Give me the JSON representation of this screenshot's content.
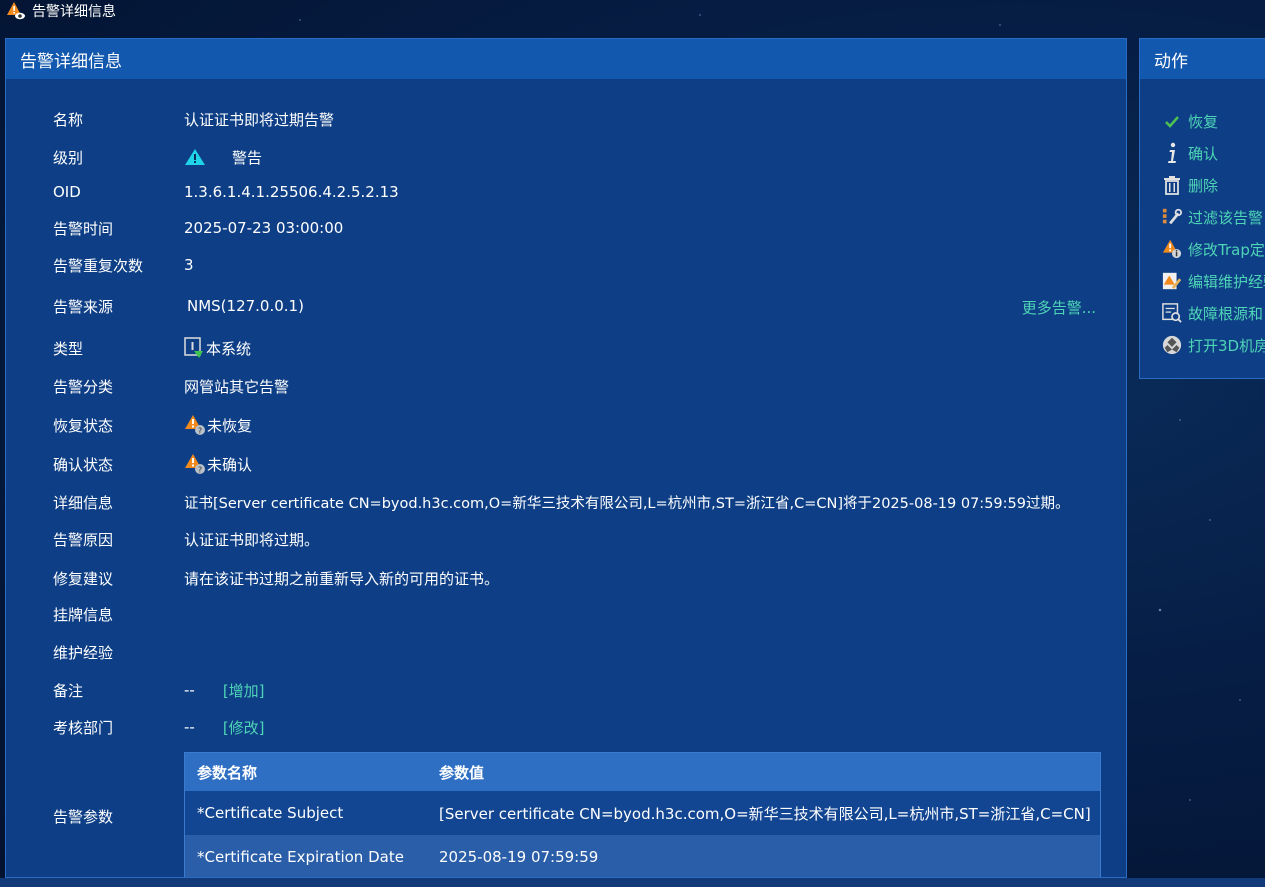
{
  "window": {
    "title": "告警详细信息"
  },
  "main": {
    "title": "告警详细信息",
    "fields": [
      {
        "key": "name",
        "label": "名称",
        "value": "认证证书即将过期告警"
      },
      {
        "key": "level",
        "label": "级别",
        "value": "警告",
        "icon": "warning-triangle-icon"
      },
      {
        "key": "oid",
        "label": "OID",
        "value": "1.3.6.1.4.1.25506.4.2.5.2.13"
      },
      {
        "key": "time",
        "label": "告警时间",
        "value": "2025-07-23 03:00:00"
      },
      {
        "key": "repeat",
        "label": "告警重复次数",
        "value": "3"
      },
      {
        "key": "source",
        "label": "告警来源",
        "value": "NMS(127.0.0.1)"
      },
      {
        "key": "type",
        "label": "类型",
        "value": "本系统",
        "icon": "local-system-icon"
      },
      {
        "key": "category",
        "label": "告警分类",
        "value": "网管站其它告警"
      },
      {
        "key": "recover",
        "label": "恢复状态",
        "value": "未恢复",
        "icon": "warning-unknown-icon"
      },
      {
        "key": "ack",
        "label": "确认状态",
        "value": "未确认",
        "icon": "warning-unknown-icon"
      },
      {
        "key": "detail",
        "label": "详细信息",
        "value": "证书[Server certificate CN=byod.h3c.com,O=新华三技术有限公司,L=杭州市,ST=浙江省,C=CN]将于2025-08-19 07:59:59过期。"
      },
      {
        "key": "reason",
        "label": "告警原因",
        "value": "认证证书即将过期。"
      },
      {
        "key": "advice",
        "label": "修复建议",
        "value": "请在该证书过期之前重新导入新的可用的证书。"
      },
      {
        "key": "tag",
        "label": "挂牌信息",
        "value": ""
      },
      {
        "key": "exp",
        "label": "维护经验",
        "value": ""
      },
      {
        "key": "note",
        "label": "备注",
        "value": "--",
        "link": "[增加]"
      },
      {
        "key": "dept",
        "label": "考核部门",
        "value": "--",
        "link": "[修改]"
      }
    ],
    "more_alarms": "更多告警...",
    "params": {
      "label": "告警参数",
      "headers": [
        "参数名称",
        "参数值"
      ],
      "rows": [
        [
          "*Certificate Subject",
          "[Server certificate CN=byod.h3c.com,O=新华三技术有限公司,L=杭州市,ST=浙江省,C=CN]"
        ],
        [
          "*Certificate Expiration Date",
          "2025-08-19 07:59:59"
        ]
      ]
    }
  },
  "side": {
    "title": "动作",
    "actions": [
      {
        "label": "恢复",
        "icon": "check-icon"
      },
      {
        "label": "确认",
        "icon": "info-icon"
      },
      {
        "label": "删除",
        "icon": "trash-icon"
      },
      {
        "label": "过滤该告警",
        "icon": "filter-wrench-icon"
      },
      {
        "label": "修改Trap定义",
        "icon": "warning-info-icon"
      },
      {
        "label": "编辑维护经验",
        "icon": "edit-warning-icon"
      },
      {
        "label": "故障根源和",
        "icon": "root-cause-icon"
      },
      {
        "label": "打开3D机房",
        "icon": "3d-room-icon"
      }
    ]
  },
  "colors": {
    "accent": "#4ed4b6",
    "panel": "#0e3f86",
    "header": "#1258ae"
  }
}
